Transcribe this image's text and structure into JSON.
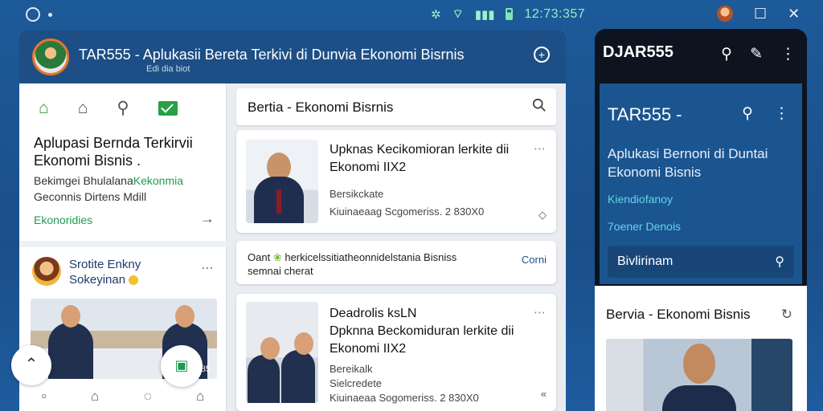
{
  "statusbar": {
    "clock": "12:73:357",
    "icons": [
      "bug-icon",
      "wifi-icon",
      "signal-icon",
      "battery-icon"
    ]
  },
  "window": {
    "title": "TAR555 - Aplukasii Bereta Terkivi di Dunvia Ekonomi Bisrnis",
    "subtitle": "Edi dia biot"
  },
  "left_pane": {
    "title": "Aplupasi Bernda Terkirvii Ekonomi Bisnis .",
    "desc_line1_a": "Bekimgei Bhulalana",
    "desc_line1_b": "Kekonmia",
    "desc_line2": "Geconnis Dirtens Mdill",
    "link": "Ekonoridies",
    "user_name_line1": "Srotite Enkny",
    "user_name_line2": "Sokeyinan",
    "photo_number": "6585"
  },
  "center_pane": {
    "bar_title": "Bertia - Ekonomi Bisrnis",
    "card1": {
      "headline": "Upknas Kecikomioran lerkite dii Ekonomi IIX2",
      "meta1": "Bersikckate",
      "meta2": "Kiuinaeaag Scgomeriss. 2 830X0"
    },
    "card2": {
      "text_a": "Oant",
      "text_b": "herkicelssitiatheonnidelstania Bisniss",
      "text_c": "semnai cherat",
      "link": "Corni"
    },
    "card3": {
      "headline1": "Deadrolis ksLN",
      "headline2": "Dpknna Beckomiduran lerkite dii Ekonomi IIX2",
      "meta1": "Bereikalk",
      "meta2": "Sielcredete",
      "meta3": "Kiuinaeaa Sogomeriss. 2 830X0"
    }
  },
  "phone": {
    "brand": "DJAR555",
    "hero_title": "TAR555 -",
    "hero_sub": "Aplukasi Bernoni di Duntai Ekonomi Bisnis",
    "link1": "Kiendiofanoy",
    "link2": "7oener Denois",
    "input_text": "Bivlirinam",
    "lower_title": "Bervia - Ekonomi Bisnis"
  },
  "colors": {
    "header_blue": "#1d4f86",
    "accent_green": "#1f9a52",
    "phone_hero": "#1b5590"
  }
}
